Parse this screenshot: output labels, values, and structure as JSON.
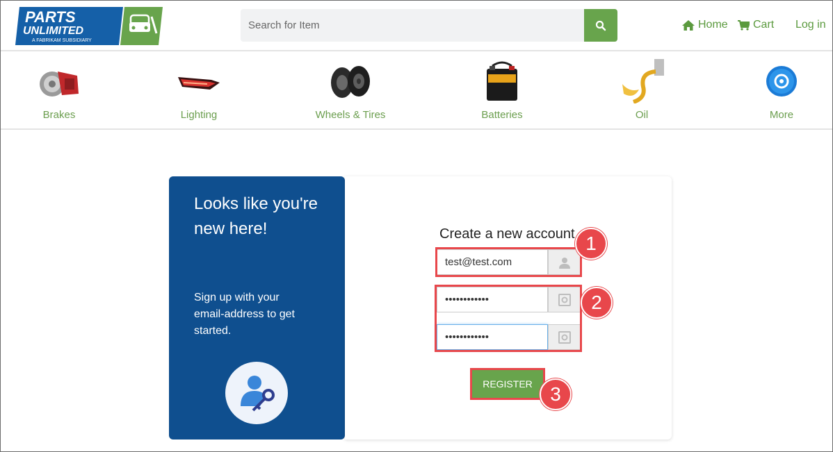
{
  "header": {
    "logo": {
      "line1": "PARTS",
      "line2": "UNLIMITED",
      "tagline": "A FABRIKAM SUBSIDIARY"
    },
    "search_placeholder": "Search for Item",
    "nav": {
      "home": "Home",
      "cart": "Cart",
      "login": "Log in"
    }
  },
  "categories": [
    {
      "label": "Brakes",
      "icon": "brake-disc-icon"
    },
    {
      "label": "Lighting",
      "icon": "tail-light-icon"
    },
    {
      "label": "Wheels & Tires",
      "icon": "tires-icon"
    },
    {
      "label": "Batteries",
      "icon": "car-battery-icon"
    },
    {
      "label": "Oil",
      "icon": "oil-pour-icon"
    },
    {
      "label": "More",
      "icon": "more-parts-icon"
    }
  ],
  "intro": {
    "heading": "Looks like you're new here!",
    "subtext": "Sign up with your email-address to get started."
  },
  "form": {
    "title": "Create a new account",
    "email_value": "test@test.com",
    "password_value": "••••••••••••",
    "confirm_value": "••••••••••••",
    "register_label": "REGISTER"
  },
  "callouts": [
    "1",
    "2",
    "3"
  ],
  "colors": {
    "brand_blue": "#0f4f8f",
    "accent_green": "#68a44c",
    "callout_red": "#e8474b"
  }
}
